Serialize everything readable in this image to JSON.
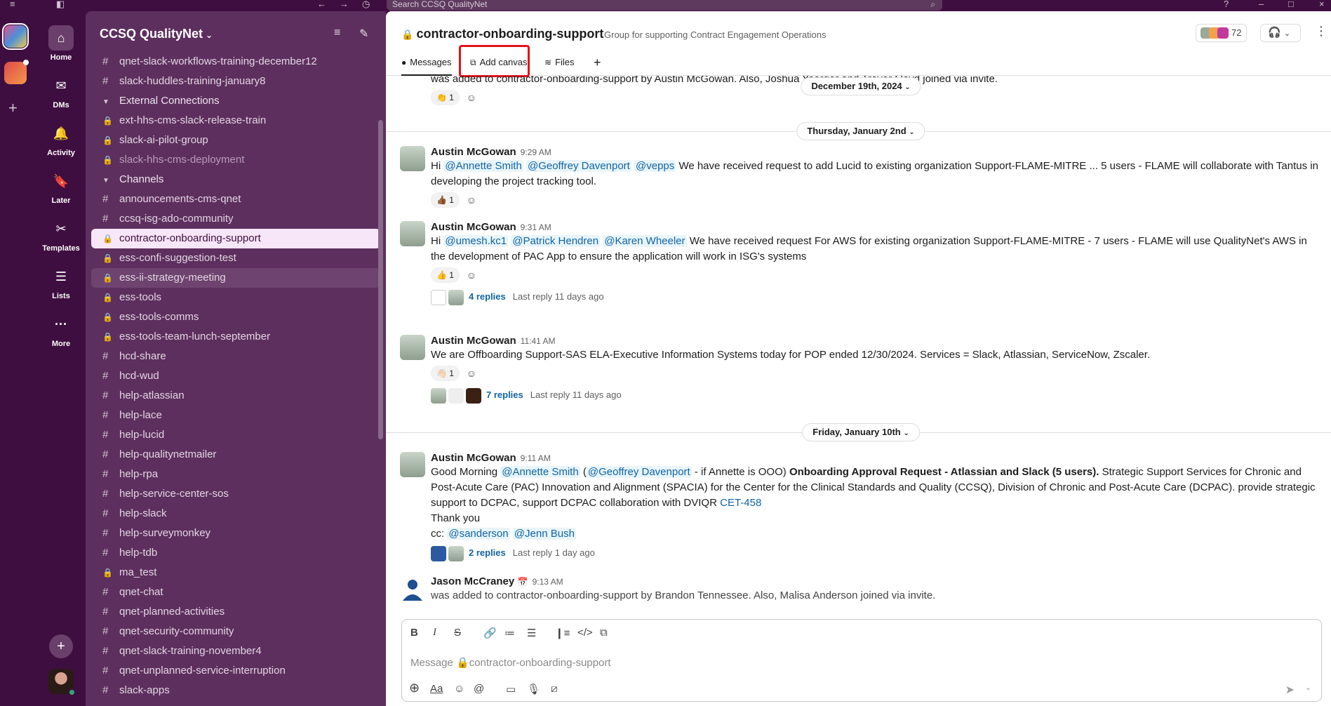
{
  "topbar": {
    "search_placeholder": "Search CCSQ QualityNet"
  },
  "workspace": {
    "name": "CCSQ QualityNet"
  },
  "nav": [
    {
      "label": "Home",
      "icon": "home-icon",
      "glyph": "⌂"
    },
    {
      "label": "DMs",
      "icon": "dm-icon",
      "glyph": "✉"
    },
    {
      "label": "Activity",
      "icon": "bell-icon",
      "glyph": "🔔"
    },
    {
      "label": "Later",
      "icon": "bookmark-icon",
      "glyph": "🔖"
    },
    {
      "label": "Templates",
      "icon": "templates-icon",
      "glyph": "✂"
    },
    {
      "label": "Lists",
      "icon": "lists-icon",
      "glyph": "☰"
    },
    {
      "label": "More",
      "icon": "more-icon",
      "glyph": "···"
    }
  ],
  "sidebar": {
    "rows": [
      {
        "type": "hash",
        "label": "qnet-slack-workflows-training-december12"
      },
      {
        "type": "hash",
        "label": "slack-huddles-training-january8"
      },
      {
        "type": "section",
        "label": "External Connections"
      },
      {
        "type": "lock",
        "label": "ext-hhs-cms-slack-release-train"
      },
      {
        "type": "lock",
        "label": "slack-ai-pilot-group"
      },
      {
        "type": "lock",
        "label": "slack-hhs-cms-deployment",
        "muted": true
      },
      {
        "type": "section",
        "label": "Channels"
      },
      {
        "type": "hash",
        "label": "announcements-cms-qnet"
      },
      {
        "type": "hash",
        "label": "ccsq-isg-ado-community"
      },
      {
        "type": "lock",
        "label": "contractor-onboarding-support",
        "active": true
      },
      {
        "type": "lock",
        "label": "ess-confi-suggestion-test"
      },
      {
        "type": "lock",
        "label": "ess-ii-strategy-meeting",
        "hover": true
      },
      {
        "type": "lock",
        "label": "ess-tools"
      },
      {
        "type": "lock",
        "label": "ess-tools-comms"
      },
      {
        "type": "lock",
        "label": "ess-tools-team-lunch-september"
      },
      {
        "type": "hash",
        "label": "hcd-share"
      },
      {
        "type": "hash",
        "label": "hcd-wud"
      },
      {
        "type": "hash",
        "label": "help-atlassian"
      },
      {
        "type": "hash",
        "label": "help-lace"
      },
      {
        "type": "hash",
        "label": "help-lucid"
      },
      {
        "type": "hash",
        "label": "help-qualitynetmailer"
      },
      {
        "type": "hash",
        "label": "help-rpa"
      },
      {
        "type": "hash",
        "label": "help-service-center-sos"
      },
      {
        "type": "hash",
        "label": "help-slack"
      },
      {
        "type": "hash",
        "label": "help-surveymonkey"
      },
      {
        "type": "hash",
        "label": "help-tdb"
      },
      {
        "type": "lock",
        "label": "ma_test"
      },
      {
        "type": "hash",
        "label": "qnet-chat"
      },
      {
        "type": "hash",
        "label": "qnet-planned-activities"
      },
      {
        "type": "hash",
        "label": "qnet-security-community"
      },
      {
        "type": "hash",
        "label": "qnet-slack-training-november4"
      },
      {
        "type": "hash",
        "label": "qnet-unplanned-service-interruption"
      },
      {
        "type": "hash",
        "label": "slack-apps"
      }
    ]
  },
  "channel": {
    "name": "contractor-onboarding-support",
    "description": "Group for supporting Contract Engagement Operations",
    "member_count": "72",
    "tabs": [
      {
        "label": "Messages",
        "icon": "messages-icon",
        "glyph": "●"
      },
      {
        "label": "Add canvas",
        "icon": "canvas-icon",
        "glyph": "⧉"
      },
      {
        "label": "Files",
        "icon": "files-icon",
        "glyph": "≋"
      },
      {
        "label": "",
        "icon": "plus-icon",
        "glyph": "+"
      }
    ]
  },
  "feed": {
    "partial_top": {
      "text": "was added to contractor-onboarding-support by Austin McGowan. Also, Joshua Yoerger and Trevor Lloyd joined via invite.",
      "reaction": "👏 1"
    },
    "dates": [
      "December 19th, 2024",
      "Thursday, January 2nd",
      "Friday, January 10th"
    ],
    "messages": [
      {
        "author": "Austin McGowan",
        "time": "9:29 AM",
        "m1": "@Annette Smith",
        "m2": "@Geoffrey Davenport",
        "m3": "@vepps",
        "pre": "Hi",
        "text": "We have received request to add Lucid to existing organization Support-FLAME-MITRE ...  5 users - FLAME will collaborate with Tantus in developing the project tracking tool.",
        "reaction": "👍🏾 1"
      },
      {
        "author": "Austin McGowan",
        "time": "9:31 AM",
        "pre": "Hi",
        "m1": "@umesh.kc1",
        "m2": "@Patrick Hendren",
        "m3": "@Karen Wheeler",
        "text": "We have received request For AWS for existing organization Support-FLAME-MITRE - 7 users - FLAME will use QualityNet's AWS in the development of PAC App to ensure the application will work in ISG's systems",
        "reaction": "👍 1",
        "replies": "4 replies",
        "last_reply": "Last reply 11 days ago"
      },
      {
        "author": "Austin McGowan",
        "time": "11:41 AM",
        "text": "We are Offboarding Support-SAS ELA-Executive Information Systems today for POP ended 12/30/2024.  Services = Slack, Atlassian, ServiceNow, Zscaler.",
        "reaction": "👋🏻 1",
        "replies": "7 replies",
        "last_reply": "Last reply 11 days ago"
      },
      {
        "author": "Austin McGowan",
        "time": "9:11 AM",
        "pre": "Good Morning",
        "m1": "@Annette Smith",
        "paren_open": "(",
        "m2": "@Geoffrey Davenport",
        "mid": " - if Annette is OOO)",
        "bold": "Onboarding Approval Request - Atlassian and Slack (5 users).",
        "text": "Strategic Support Services for Chronic and Post-Acute Care (PAC) Innovation and Alignment (SPACIA) for the Center for the Clinical Standards and Quality (CCSQ), Division of Chronic and Post-Acute Care (DCPAC). provide strategic support to DCPAC, support DCPAC collaboration with DVIQR",
        "link": "CET-458",
        "thanks": "Thank you",
        "cc": "cc:",
        "m3": "@sanderson",
        "m4": "@Jenn Bush",
        "replies": "2 replies",
        "last_reply": "Last reply 1 day ago"
      },
      {
        "author": "Jason McCraney",
        "time": "9:13 AM",
        "status_emoji": "📅",
        "text": "was added to contractor-onboarding-support by Brandon Tennessee. Also, Malisa Anderson joined via invite."
      }
    ]
  },
  "composer": {
    "placeholder": "Message 🔒contractor-onboarding-support"
  }
}
